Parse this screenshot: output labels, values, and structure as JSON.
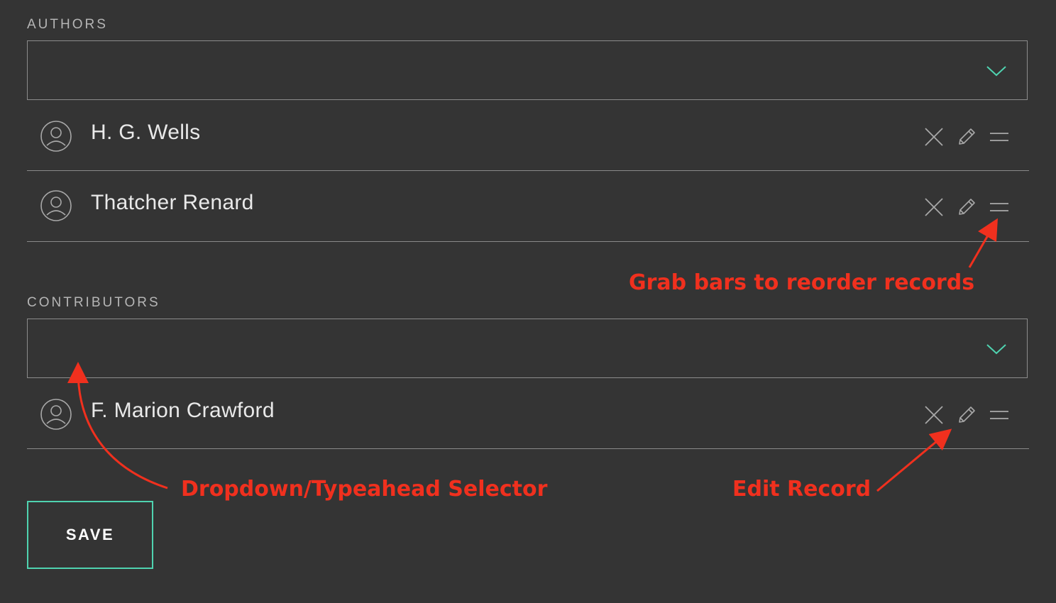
{
  "authors": {
    "label": "AUTHORS",
    "records": [
      {
        "name": "H. G. Wells"
      },
      {
        "name": "Thatcher Renard"
      }
    ]
  },
  "contributors": {
    "label": "CONTRIBUTORS",
    "records": [
      {
        "name": "F. Marion Crawford"
      }
    ]
  },
  "save_label": "SAVE",
  "annotations": {
    "grab_bars": "Grab bars to reorder records",
    "dropdown": "Dropdown/Typeahead Selector",
    "edit_record": "Edit Record"
  },
  "icons": {
    "chevron": "chevron-down-icon",
    "avatar": "user-circle-icon",
    "remove": "close-icon",
    "edit": "pencil-icon",
    "drag": "drag-handle-icon"
  },
  "colors": {
    "background": "#343434",
    "accent": "#4fd3b0",
    "annotation": "#f0301e",
    "border": "#8c8c8c",
    "text": "#e9e9e9"
  }
}
